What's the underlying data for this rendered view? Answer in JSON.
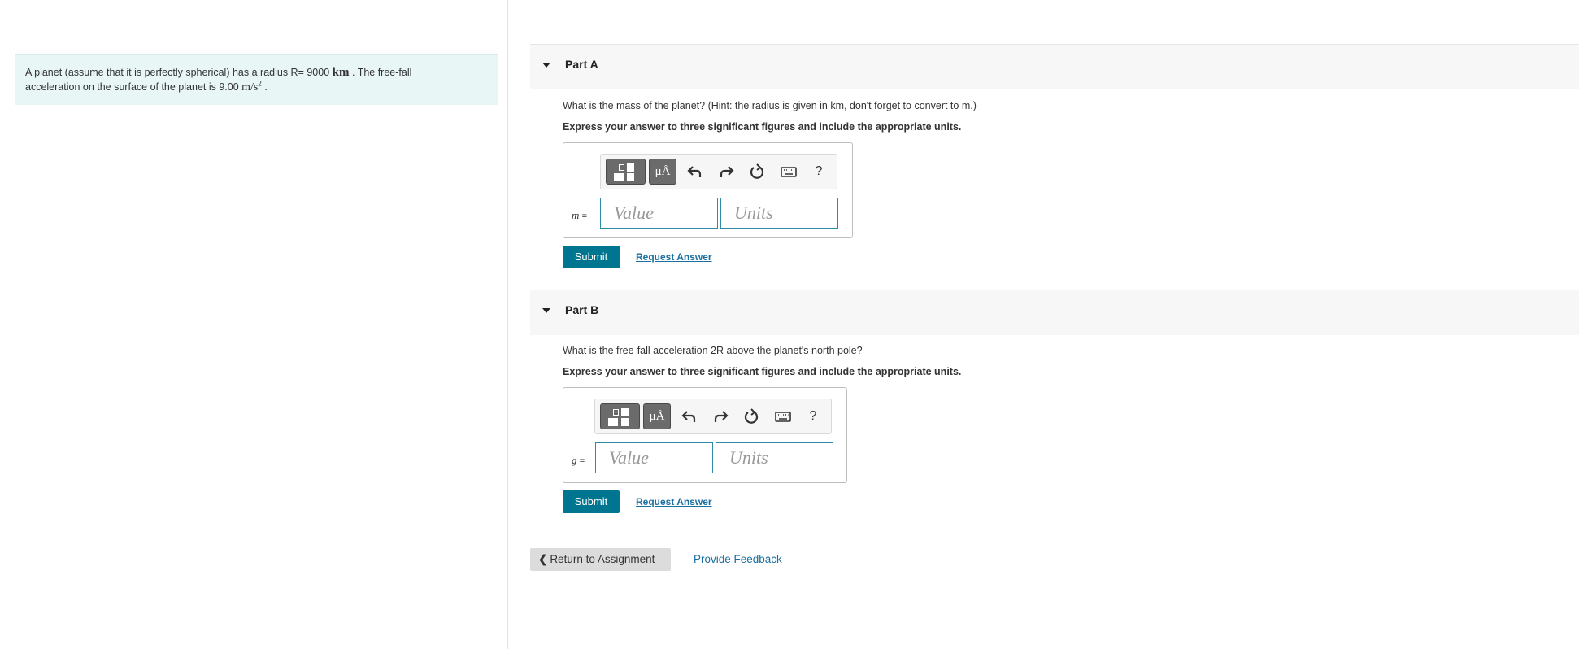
{
  "problem": {
    "text_1": "A planet (assume that it is perfectly spherical) has a radius R= 9000",
    "radius_unit": "km",
    "text_2": ". The free-fall",
    "text_3": "acceleration on the surface of the planet is 9.00",
    "accel_unit": "m/s",
    "accel_exp": "2",
    "text_4": "."
  },
  "parts": [
    {
      "title": "Part A",
      "question": "What is the mass of the planet? (Hint: the radius is given in km, don't forget to convert to m.)",
      "instruction": "Express your answer to three significant figures and include the appropriate units.",
      "variable": "m",
      "eq": "=",
      "value_placeholder": "Value",
      "units_placeholder": "Units",
      "units_tool_label": "μÅ",
      "help_label": "?",
      "submit_label": "Submit",
      "request_label": "Request Answer"
    },
    {
      "title": "Part B",
      "question": "What is the free-fall acceleration 2R above the planet's north pole?",
      "instruction": "Express your answer to three significant figures and include the appropriate units.",
      "variable": "g",
      "eq": "=",
      "value_placeholder": "Value",
      "units_placeholder": "Units",
      "units_tool_label": "μÅ",
      "help_label": "?",
      "submit_label": "Submit",
      "request_label": "Request Answer"
    }
  ],
  "footer": {
    "return_label": "Return to Assignment",
    "feedback_label": "Provide Feedback"
  },
  "colors": {
    "primary": "#00758f",
    "link": "#1a6fa0",
    "problem_bg": "#e8f6f6"
  }
}
